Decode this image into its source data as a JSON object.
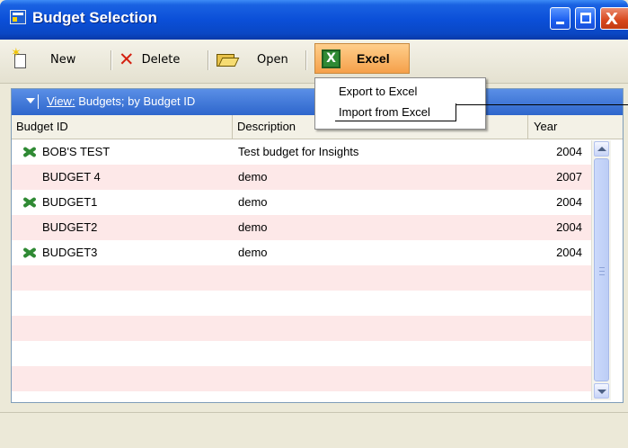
{
  "window": {
    "title": "Budget Selection",
    "minimize_glyph": "",
    "maximize_glyph": "",
    "close_glyph": "X"
  },
  "toolbar": {
    "new_label": "New",
    "delete_label": "Delete",
    "open_label": "Open",
    "excel_label": "Excel",
    "excel_icon_letter": "X"
  },
  "view": {
    "prefix": "View:",
    "label": "Budgets; by Budget ID"
  },
  "columns": {
    "budget_id": "Budget ID",
    "description": "Description",
    "year": "Year"
  },
  "rows": [
    {
      "budget_id": "BOB'S TEST",
      "description": "Test budget for Insights",
      "year": "2004",
      "excel_linked": true
    },
    {
      "budget_id": "BUDGET 4",
      "description": "demo",
      "year": "2007",
      "excel_linked": false
    },
    {
      "budget_id": "BUDGET1",
      "description": "demo",
      "year": "2004",
      "excel_linked": true
    },
    {
      "budget_id": "BUDGET2",
      "description": "demo",
      "year": "2004",
      "excel_linked": false
    },
    {
      "budget_id": "BUDGET3",
      "description": "demo",
      "year": "2004",
      "excel_linked": true
    }
  ],
  "excel_menu": {
    "export": "Export to Excel",
    "import": "Import from Excel"
  },
  "colors": {
    "title_bar": "#0b4fd8",
    "view_bar": "#2e66cc",
    "excel_button": "#f5a04a",
    "row_alt": "#fde8e8",
    "excel_green": "#2f8a34"
  }
}
